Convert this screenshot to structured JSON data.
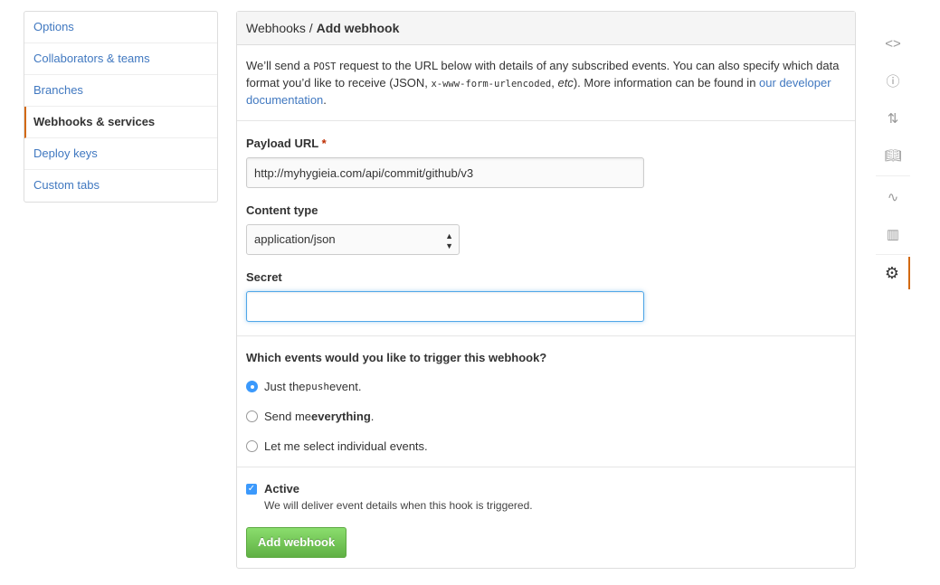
{
  "menu": {
    "items": [
      {
        "label": "Options"
      },
      {
        "label": "Collaborators & teams"
      },
      {
        "label": "Branches"
      },
      {
        "label": "Webhooks & services",
        "selected": true
      },
      {
        "label": "Deploy keys"
      },
      {
        "label": "Custom tabs"
      }
    ]
  },
  "header": {
    "parent": "Webhooks",
    "sep": " / ",
    "title": "Add webhook"
  },
  "intro": {
    "t1": "We’ll send a ",
    "code1": "POST",
    "t2": " request to the URL below with details of any subscribed events. You can also specify which data format you’d like to receive (JSON, ",
    "code2": "x-www-form-urlencoded",
    "t3": ", ",
    "em": "etc",
    "t4": "). More information can be found in ",
    "link": "our developer documentation",
    "t5": "."
  },
  "form": {
    "payload_label": "Payload URL",
    "required": "*",
    "payload_value": "http://myhygieia.com/api/commit/github/v3",
    "content_label": "Content type",
    "content_value": "application/json",
    "secret_label": "Secret",
    "secret_value": ""
  },
  "events": {
    "question": "Which events would you like to trigger this webhook?",
    "opt1_a": "Just the ",
    "opt1_code": "push",
    "opt1_b": " event.",
    "opt2_a": "Send me ",
    "opt2_b": "everything",
    "opt2_c": ".",
    "opt3": "Let me select individual events.",
    "selected": 1
  },
  "active": {
    "label": "Active",
    "checked": true,
    "desc": "We will deliver event details when this hook is triggered."
  },
  "submit": "Add webhook",
  "colors": {
    "accent": "#d26911",
    "link": "#4078c0",
    "button": "#60b044"
  },
  "rail": {
    "icons": [
      "code-icon",
      "issue-icon",
      "pull-request-icon",
      "wiki-icon",
      "pulse-icon",
      "graph-icon",
      "gear-icon"
    ]
  }
}
